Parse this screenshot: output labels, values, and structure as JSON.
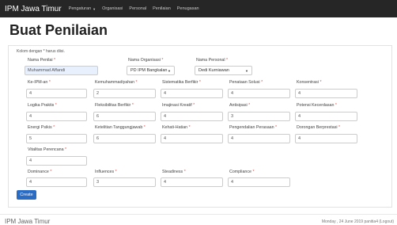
{
  "navbar": {
    "brand": "IPM Jawa Timur",
    "items": [
      {
        "label": "Pengaturan",
        "has_caret": true
      },
      {
        "label": "Organisasi"
      },
      {
        "label": "Personal"
      },
      {
        "label": "Penilaian"
      },
      {
        "label": "Penugasan"
      }
    ]
  },
  "page": {
    "title": "Buat Penilaian",
    "required_note": "Kolom dengan * harus diisi."
  },
  "form": {
    "nama_penilai": {
      "label": "Nama Penilai",
      "value": "Muhammad Affandi"
    },
    "nama_organisasi": {
      "label": "Nama Organisasi",
      "value": "PD IPM Bangkalan"
    },
    "nama_personal": {
      "label": "Nama Personal",
      "value": "Dedi Kurniawan"
    },
    "fields": [
      {
        "label": "Ke-IPM-an",
        "value": "4"
      },
      {
        "label": "Kemuhammadiyahan",
        "value": "2"
      },
      {
        "label": "Sistematika Berfikir",
        "value": "4"
      },
      {
        "label": "Penataan Solusi",
        "value": "4"
      },
      {
        "label": "Konsentrasi",
        "value": "4"
      },
      {
        "label": "Logika Praktis",
        "value": "4"
      },
      {
        "label": "Fleksibilitas Berfikir",
        "value": "6"
      },
      {
        "label": "Imajinasi Kreatif",
        "value": "4"
      },
      {
        "label": "Antisipasi",
        "value": "3"
      },
      {
        "label": "Potensi Kecerdasan",
        "value": "4"
      },
      {
        "label": "Energi Psikis",
        "value": "5"
      },
      {
        "label": "Ketelitian Tanggungjawab",
        "value": "6"
      },
      {
        "label": "Kehati-Hatian",
        "value": "4"
      },
      {
        "label": "Pengendalian Perasaan",
        "value": "4"
      },
      {
        "label": "Dorongan Berprestasi",
        "value": "4"
      },
      {
        "label": "Vitalitas Perencana",
        "value": "4"
      },
      {
        "label": "Dominance",
        "value": "4"
      },
      {
        "label": "Influences",
        "value": "3"
      },
      {
        "label": "Steadiness",
        "value": "4"
      },
      {
        "label": "Compliance",
        "value": "4"
      }
    ],
    "submit_label": "Create"
  },
  "footer": {
    "left": "IPM Jawa Timur",
    "right": "Monday , 24 June 2019    panitia4 (Logout)"
  }
}
